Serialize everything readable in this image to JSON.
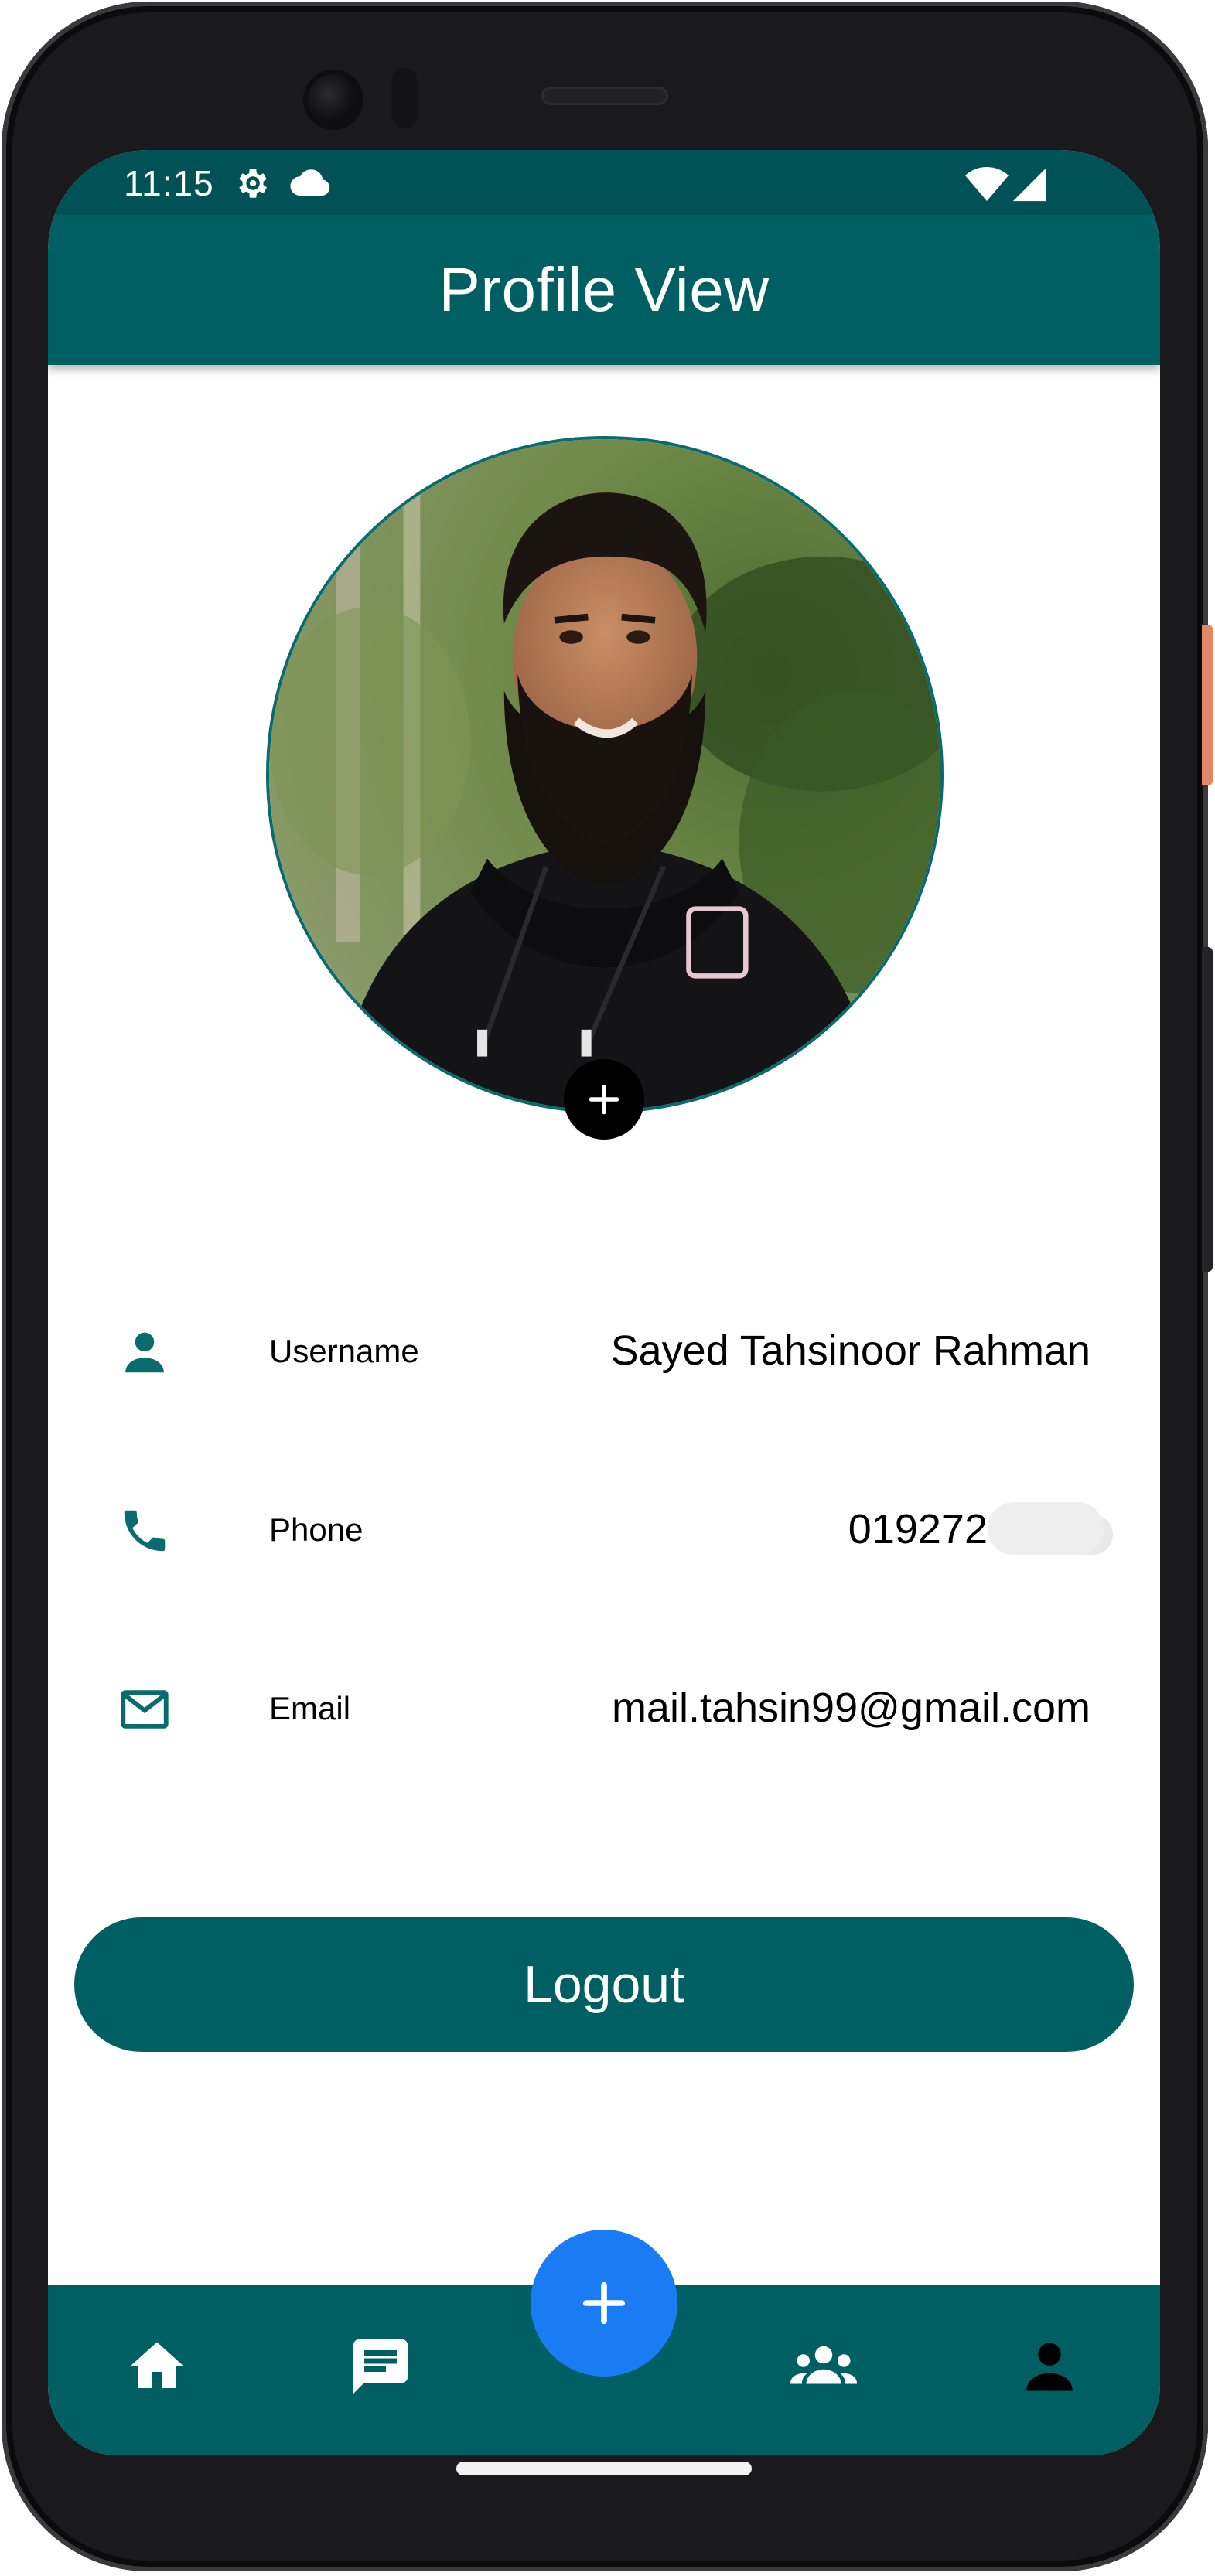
{
  "status_bar": {
    "time": "11:15",
    "icons": [
      "settings-gear-icon",
      "cloud-icon",
      "wifi-icon",
      "cell-signal-icon"
    ]
  },
  "app_bar": {
    "title": "Profile View"
  },
  "profile": {
    "avatar_alt": "profile-photo",
    "add_photo_icon": "plus-icon",
    "fields": [
      {
        "icon": "person-icon",
        "label": "Username",
        "value": "Sayed Tahsinoor Rahman"
      },
      {
        "icon": "phone-icon",
        "label": "Phone",
        "value": "019272"
      },
      {
        "icon": "mail-icon",
        "label": "Email",
        "value": "mail.tahsin99@gmail.com"
      }
    ]
  },
  "actions": {
    "logout_label": "Logout"
  },
  "bottom_nav": {
    "items": [
      {
        "icon": "home-icon"
      },
      {
        "icon": "chat-icon"
      },
      {
        "icon": "groups-icon"
      },
      {
        "icon": "person-icon"
      }
    ],
    "fab_icon": "plus-icon"
  },
  "colors": {
    "primary": "#005F63",
    "fab": "#1A7CF5",
    "icon_teal": "#0A6B6E"
  }
}
